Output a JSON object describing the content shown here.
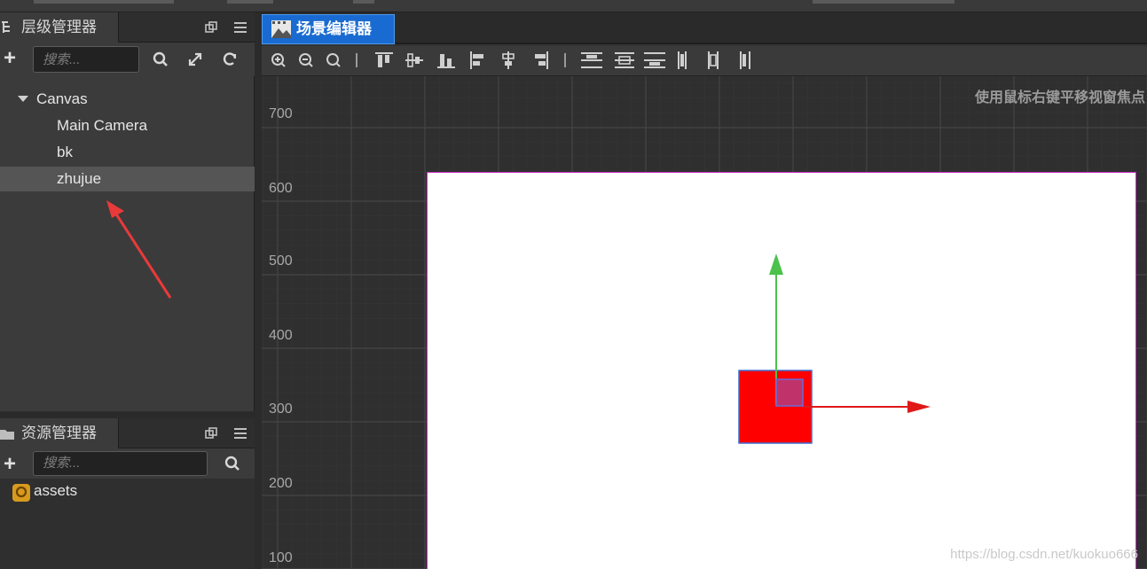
{
  "hierarchy_panel": {
    "title": "层级管理器",
    "search_placeholder": "搜索...",
    "tree": {
      "root": "Canvas",
      "children": [
        "Main Camera",
        "bk",
        "zhujue"
      ],
      "selected": "zhujue"
    }
  },
  "assets_panel": {
    "title": "资源管理器",
    "search_placeholder": "搜索...",
    "items": [
      "assets"
    ]
  },
  "scene_editor": {
    "tab_label": "场景编辑器",
    "hint": "使用鼠标右键平移视窗焦点，使",
    "y_axis_labels": [
      "700",
      "600",
      "500",
      "400",
      "300",
      "200",
      "100"
    ],
    "watermark": "https://blog.csdn.net/kuokuo666"
  },
  "colors": {
    "tab_active": "#1a6bd1",
    "selection_row": "#555555",
    "canvas_border": "#c832c8",
    "node_fill": "#ff0000",
    "gizmo_x": "#e01818",
    "gizmo_y": "#4cc24c",
    "annotation_arrow": "#e83a3a"
  },
  "icons": {
    "hierarchy_toolbar": [
      "add-icon",
      "search-icon",
      "expand-icon",
      "refresh-icon"
    ],
    "assets_toolbar": [
      "add-icon",
      "search-icon"
    ],
    "panel_header": [
      "popout-icon",
      "menu-icon"
    ]
  }
}
